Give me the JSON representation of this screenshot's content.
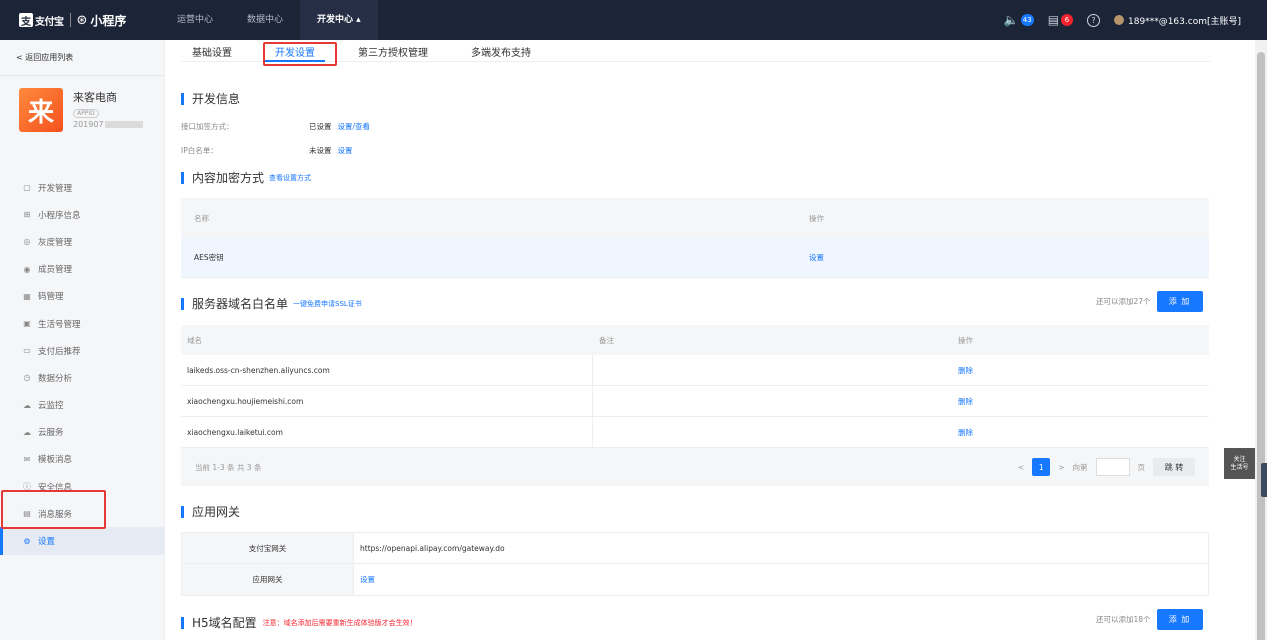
{
  "topbar": {
    "brand_logo": "支",
    "brand_text": "支付宝",
    "mini_icon": "mini-program-icon",
    "mini_text": "小程序",
    "nav": [
      {
        "label": "运营中心"
      },
      {
        "label": "数据中心"
      },
      {
        "label": "开发中心 ▴"
      }
    ],
    "notice_count": "43",
    "todo_count": "6",
    "help": "?",
    "account": "189***@163.com[主账号]"
  },
  "sidebar": {
    "back": "< 返回应用列表",
    "app": {
      "logo_char": "来",
      "name": "来客电商",
      "tag": "APPID",
      "id": "201907"
    },
    "menu": [
      {
        "label": "开发管理",
        "icon": "▢"
      },
      {
        "label": "小程序信息",
        "icon": "⊞"
      },
      {
        "label": "灰度管理",
        "icon": "◎"
      },
      {
        "label": "成员管理",
        "icon": "◉"
      },
      {
        "label": "码管理",
        "icon": "▦"
      },
      {
        "label": "生活号管理",
        "icon": "▣"
      },
      {
        "label": "支付后推荐",
        "icon": "▭"
      },
      {
        "label": "数据分析",
        "icon": "◷"
      },
      {
        "label": "云监控",
        "icon": "☁"
      },
      {
        "label": "云服务",
        "icon": "☁"
      },
      {
        "label": "模板消息",
        "icon": "✉"
      },
      {
        "label": "安全信息",
        "icon": "ⓘ"
      },
      {
        "label": "消息服务",
        "icon": "▤"
      },
      {
        "label": "设置",
        "icon": "⚙"
      }
    ]
  },
  "tabs": [
    {
      "label": "基础设置"
    },
    {
      "label": "开发设置"
    },
    {
      "label": "第三方授权管理"
    },
    {
      "label": "多端发布支持"
    }
  ],
  "dev_info": {
    "title": "开发信息",
    "rows": [
      {
        "label": "接口加签方式：",
        "value": "已设置",
        "link": "设置/查看"
      },
      {
        "label": "IP白名单：",
        "value": "未设置",
        "link": "设置"
      }
    ]
  },
  "encrypt": {
    "title": "内容加密方式",
    "sub": "查看设置方式",
    "head": [
      "名称",
      "操作"
    ],
    "row": {
      "name": "AES密钥",
      "action": "设置"
    }
  },
  "domains": {
    "title": "服务器域名白名单",
    "sub": "一键免费申请SSL证书",
    "remaining": "还可以添加27个",
    "add": "添 加",
    "head": [
      "域名",
      "备注",
      "操作"
    ],
    "rows": [
      {
        "domain": "laikeds.oss-cn-shenzhen.aliyuncs.com",
        "note": "",
        "action": "删除"
      },
      {
        "domain": "xiaochengxu.houjiemeishi.com",
        "note": "",
        "action": "删除"
      },
      {
        "domain": "xiaochengxu.laiketui.com",
        "note": "",
        "action": "删除"
      }
    ],
    "pager": {
      "summary": "当前 1-3 条 共 3 条",
      "prev": "<",
      "page": "1",
      "next": ">",
      "goto": "向第",
      "unit": "页",
      "jump": "跳 转"
    }
  },
  "gateway": {
    "title": "应用网关",
    "rows": [
      {
        "label": "支付宝网关",
        "value": "https://openapi.alipay.com/gateway.do"
      },
      {
        "label": "应用网关",
        "value": "设置"
      }
    ]
  },
  "h5": {
    "title": "H5域名配置",
    "warn": "注意：域名添加后需要重新生成体验版才会生效！",
    "remaining": "还可以添加18个",
    "add": "添 加"
  },
  "follow": {
    "line1": "关注",
    "line2": "生活号"
  }
}
